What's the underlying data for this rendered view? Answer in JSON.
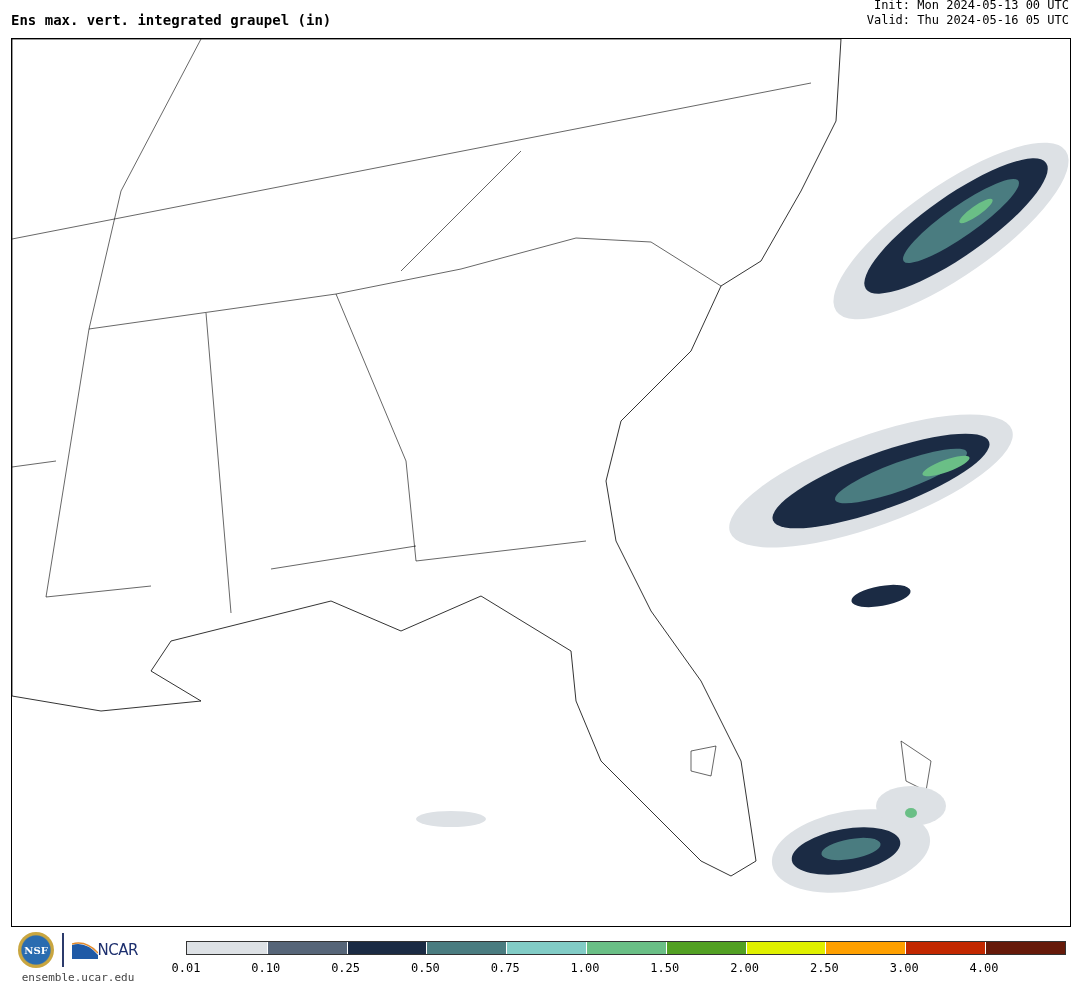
{
  "header": {
    "title": "Ens max. vert. integrated graupel (in)",
    "init": "Init: Mon 2024-05-13 00 UTC",
    "valid": "Valid: Thu 2024-05-16 05 UTC"
  },
  "footer": {
    "logos": [
      {
        "kind": "nsf",
        "text": "NSF"
      },
      {
        "kind": "ncar",
        "text": "NCAR"
      }
    ],
    "site": "ensemble.ucar.edu"
  },
  "colorbar": {
    "bins": [
      {
        "color": "#dde1e5"
      },
      {
        "color": "#566578"
      },
      {
        "color": "#1b2b44"
      },
      {
        "color": "#4a7c80"
      },
      {
        "color": "#82ccc6"
      },
      {
        "color": "#6abf86"
      },
      {
        "color": "#52a023"
      },
      {
        "color": "#e0f000"
      },
      {
        "color": "#ffa000"
      },
      {
        "color": "#c22800"
      },
      {
        "color": "#661a0a"
      }
    ],
    "ticks": [
      "0.01",
      "0.10",
      "0.25",
      "0.50",
      "0.75",
      "1.00",
      "1.50",
      "2.00",
      "2.50",
      "3.00",
      "4.00"
    ]
  }
}
